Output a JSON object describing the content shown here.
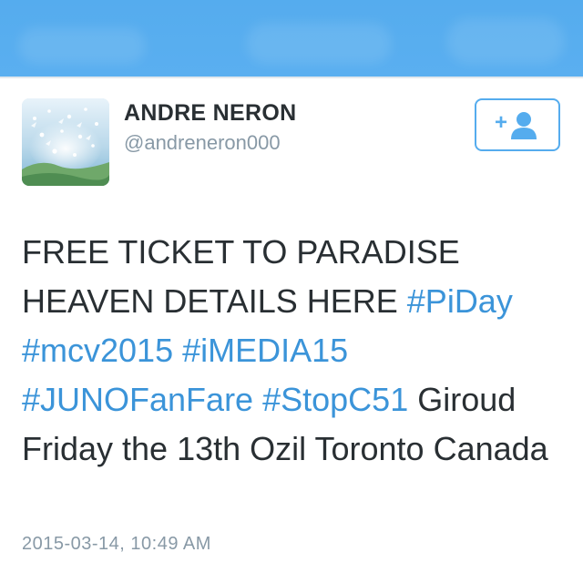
{
  "header": {
    "background_color": "#55acee"
  },
  "user": {
    "display_name": "ANDRE NERON",
    "handle": "@andreneron000",
    "avatar_icon": "profile-photo"
  },
  "follow_button": {
    "icon": "add-user-icon",
    "plus_glyph": "+",
    "accent_color": "#55acee"
  },
  "tweet": {
    "segments": [
      {
        "text": "FREE TICKET TO PARADISE HEAVEN DETAILS HERE ",
        "type": "text"
      },
      {
        "text": "#PiDay",
        "type": "hashtag"
      },
      {
        "text": " ",
        "type": "text"
      },
      {
        "text": "#mcv2015",
        "type": "hashtag"
      },
      {
        "text": " ",
        "type": "text"
      },
      {
        "text": "#iMEDIA15",
        "type": "hashtag"
      },
      {
        "text": " ",
        "type": "text"
      },
      {
        "text": "#JUNOFanFare",
        "type": "hashtag"
      },
      {
        "text": " ",
        "type": "text"
      },
      {
        "text": "#StopC51",
        "type": "hashtag"
      },
      {
        "text": " Giroud Friday the 13th Ozil Toronto Canada",
        "type": "text"
      }
    ],
    "hashtag_color": "#3b94d9",
    "timestamp": "2015-03-14, 10:49 AM"
  }
}
